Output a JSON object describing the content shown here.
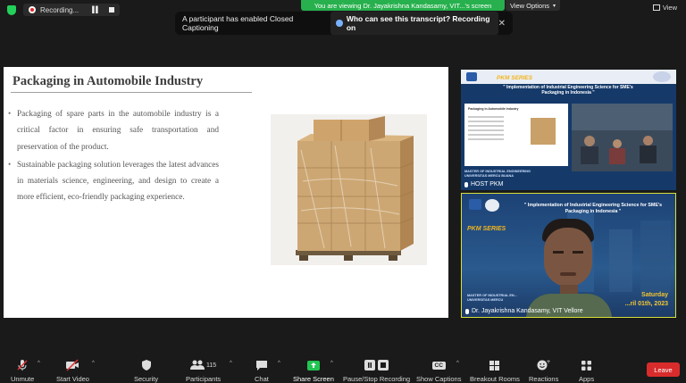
{
  "top_bar": {
    "recording_label": "Recording...",
    "viewing_banner": "You are viewing Dr. Jayakrishna Kandasamy, VIT...'s screen",
    "view_options_label": "View Options",
    "view_label": "View"
  },
  "notification": {
    "message": "A participant has enabled Closed Captioning",
    "link": "Who can see this transcript? Recording on"
  },
  "slide": {
    "title": "Packaging in Automobile Industry",
    "bullets": [
      "Packaging of spare parts in the automobile industry is a critical factor in ensuring safe transportation and preservation of the product.",
      "Sustainable packaging solution leverages the latest advances in materials science, engineering, and design to create a more efficient, eco-friendly packaging experience."
    ]
  },
  "tiles": {
    "host": {
      "series": "PKM SERIES",
      "subtitle": "\" Implementation of Industrial Engineering Science for SME's Packaging in Indonesia \"",
      "mini_slide_title": "Packaging in Automobile Industry",
      "name": "HOST PKM"
    },
    "speaker": {
      "series": "PKM SERIES",
      "subtitle": "\" Implementation of Industrial Engineering Science for SME's Packaging in Indonesia \"",
      "day": "Saturday",
      "date": "...ril 01th, 2023",
      "name": "Dr. Jayakrishna Kandasamy, VIT Vellore"
    }
  },
  "toolbar": {
    "unmute": "Unmute",
    "start_video": "Start Video",
    "security": "Security",
    "participants": "Participants",
    "participants_count": "115",
    "chat": "Chat",
    "share_screen": "Share Screen",
    "pause_stop_recording": "Pause/Stop Recording",
    "show_captions": "Show Captions",
    "cc_badge": "CC",
    "breakout_rooms": "Breakout Rooms",
    "reactions": "Reactions",
    "apps": "Apps",
    "leave": "Leave"
  },
  "colors": {
    "banner_green": "#27b04d",
    "leave_red": "#d82c2c",
    "active_speaker_border": "#d7e038",
    "share_green": "#23c552"
  }
}
